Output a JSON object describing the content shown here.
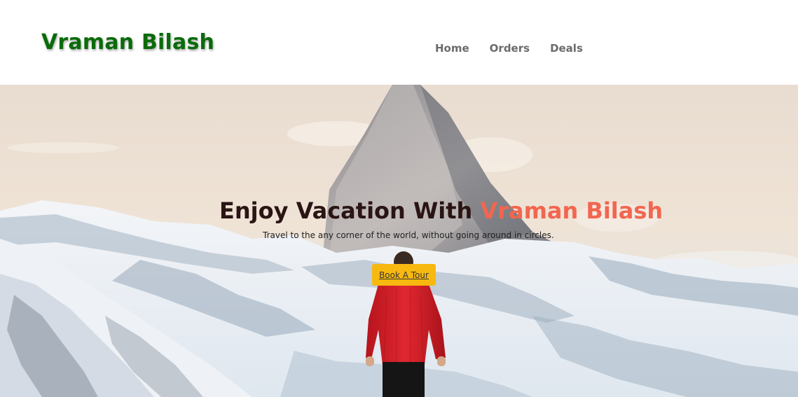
{
  "header": {
    "brand": "Vraman Bilash",
    "nav": [
      "Home",
      "Orders",
      "Deals"
    ]
  },
  "hero": {
    "headline_prefix": "Enjoy Vacation With ",
    "headline_accent": "Vraman Bilash",
    "subtitle": "Travel to the any corner of the world, without going around in circles.",
    "cta_label": "Book A Tour"
  },
  "colors": {
    "brand": "#0a6b0a",
    "accent": "#f2664f",
    "cta": "#f7b810",
    "nav_text": "#6b6b6b"
  }
}
